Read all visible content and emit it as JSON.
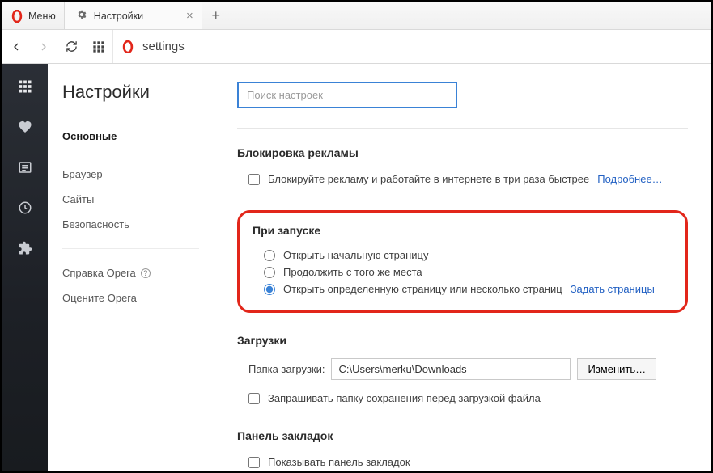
{
  "titlebar": {
    "menu_label": "Меню",
    "tab_label": "Настройки"
  },
  "navbar": {
    "url_text": "settings"
  },
  "sidebar_nav": {
    "title": "Настройки",
    "items": [
      "Основные",
      "Браузер",
      "Сайты",
      "Безопасность"
    ],
    "help": "Справка Opera",
    "rate": "Оцените Opera"
  },
  "content": {
    "search_placeholder": "Поиск настроек",
    "adblock": {
      "title": "Блокировка рекламы",
      "checkbox_label": "Блокируйте рекламу и работайте в интернете в три раза быстрее",
      "more": "Подробнее…"
    },
    "startup": {
      "title": "При запуске",
      "opt1": "Открыть начальную страницу",
      "opt2": "Продолжить с того же места",
      "opt3": "Открыть определенную страницу или несколько страниц",
      "set_pages": "Задать страницы"
    },
    "downloads": {
      "title": "Загрузки",
      "folder_label": "Папка загрузки:",
      "folder_value": "C:\\Users\\merku\\Downloads",
      "change_btn": "Изменить…",
      "ask_label": "Запрашивать папку сохранения перед загрузкой файла"
    },
    "bookmarks": {
      "title": "Панель закладок",
      "show_label": "Показывать панель закладок"
    }
  }
}
